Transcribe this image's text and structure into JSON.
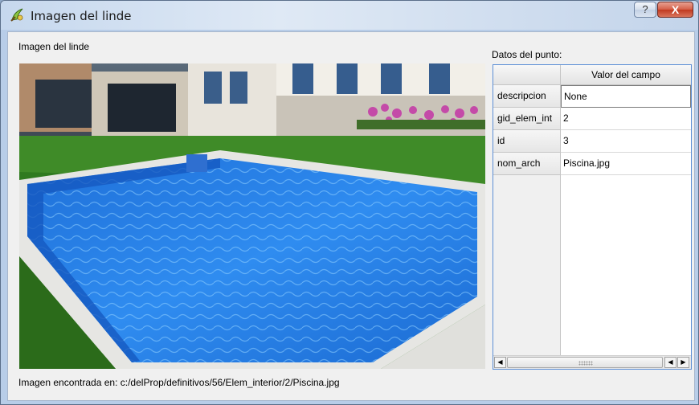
{
  "window": {
    "title": "Imagen del linde",
    "help_label": "?",
    "close_label": "X"
  },
  "image_panel": {
    "label": "Imagen del linde",
    "footer": "Imagen encontrada en: c:/delProp/definitivos/56/Elem_interior/2/Piscina.jpg"
  },
  "data_panel": {
    "label": "Datos del punto:",
    "column_header": "Valor del campo",
    "rows": [
      {
        "field": "descripcion",
        "value": "None"
      },
      {
        "field": "gid_elem_int",
        "value": "2"
      },
      {
        "field": "id",
        "value": "3"
      },
      {
        "field": "nom_arch",
        "value": "Piscina.jpg"
      }
    ],
    "scroll_left": "◀",
    "scroll_right": "▶"
  },
  "colors": {
    "titlebar": "#c6d8ee",
    "accent_border": "#5c8fd6",
    "close_button": "#c0391f"
  },
  "icons": [
    "qgis-icon",
    "help-icon",
    "close-icon",
    "scroll-left-icon",
    "scroll-right-icon"
  ]
}
